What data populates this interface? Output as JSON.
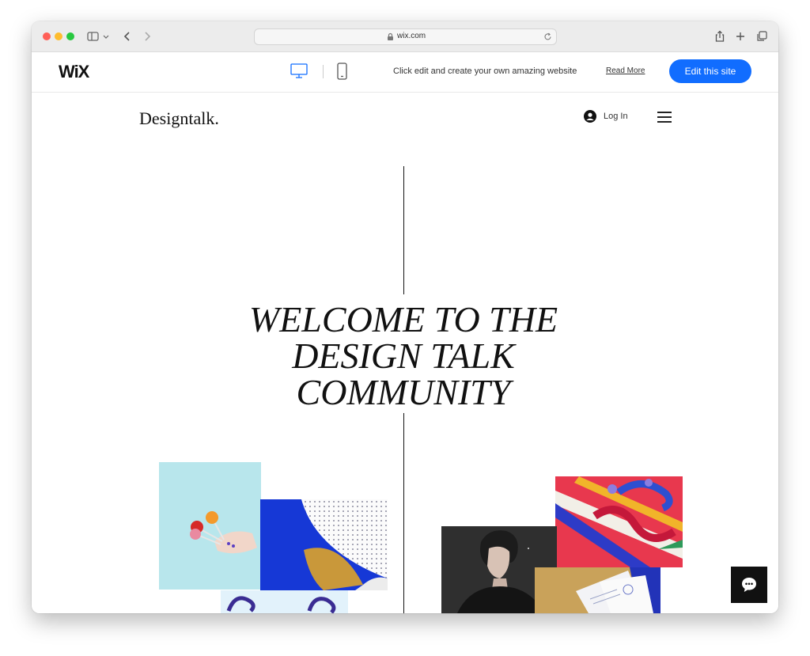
{
  "browser": {
    "url": "wix.com",
    "colors": {
      "close": "#ff5f57",
      "minimize": "#febc2e",
      "zoom": "#28c840"
    }
  },
  "wix_bar": {
    "logo": "WiX",
    "promo_text": "Click edit and create your own amazing website",
    "read_more": "Read More",
    "edit_button": "Edit this site",
    "accent_color": "#116dff"
  },
  "site": {
    "brand": "Designtalk.",
    "login": "Log In",
    "headline": [
      "WELCOME TO THE",
      "DESIGN TALK",
      "COMMUNITY"
    ]
  }
}
